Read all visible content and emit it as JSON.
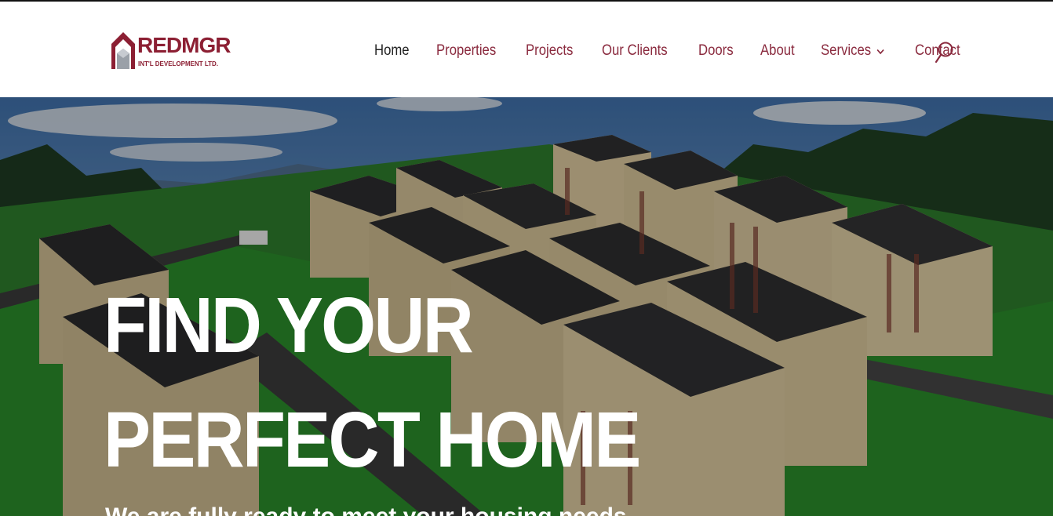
{
  "brand": {
    "logo_main": "REDMGR",
    "logo_sub": "INT'L DEVELOPMENT LTD.",
    "primary_color": "#8c1f33",
    "accent_grey": "#7c7f86"
  },
  "nav": {
    "items": [
      {
        "label": "Home",
        "active": true
      },
      {
        "label": "Properties"
      },
      {
        "label": "Projects"
      },
      {
        "label": "Our Clients"
      },
      {
        "label": "Doors"
      },
      {
        "label": "About"
      },
      {
        "label": "Services",
        "has_dropdown": true
      },
      {
        "label": "Contact"
      }
    ],
    "search_icon": "search-icon",
    "dropdown_icon": "chevron-down-icon"
  },
  "hero": {
    "headline_line1": "FIND YOUR",
    "headline_line2": "PERFECT HOME",
    "subline": "We are fully ready to meet your housing needs"
  }
}
